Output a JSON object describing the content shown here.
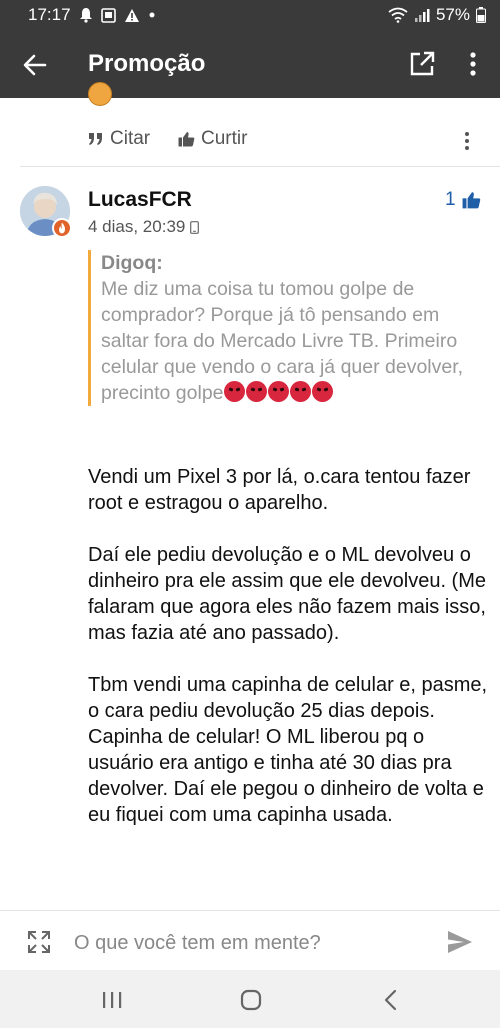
{
  "status_bar": {
    "time": "17:17",
    "battery": "57%",
    "icons": [
      "notification-icon",
      "image-icon",
      "alert-icon",
      "dot-icon",
      "wifi-icon",
      "signal-icon",
      "battery-icon"
    ]
  },
  "app_bar": {
    "title": "Promoção",
    "back_icon": "arrow-left-icon",
    "open_icon": "open-external-icon",
    "more_icon": "more-vertical-icon"
  },
  "prev_post": {
    "actions": {
      "cite_label": "Citar",
      "like_label": "Curtir"
    }
  },
  "post": {
    "username": "LucasFCR",
    "time": "4 dias, 20:39",
    "likes": "1",
    "quote": {
      "author": "Digoq:",
      "text": "Me diz uma coisa tu tomou golpe de comprador? Porque já tô pensando em saltar fora do Mercado Livre TB. Primeiro celular que vendo o cara já quer devolver, precinto golpe"
    },
    "paragraphs": [
      "Vendi um Pixel 3 por lá, o.cara tentou fazer root e estragou o aparelho.",
      "Daí ele pediu devolução e o ML devolveu o dinheiro pra ele assim que ele devolveu. (Me falaram que agora eles não fazem mais isso, mas fazia até ano passado).",
      "Tbm vendi uma capinha de celular e, pasme, o cara pediu devolução 25 dias depois. Capinha de celular! O ML liberou pq o usuário era antigo e tinha até 30 dias pra devolver. Daí ele pegou o dinheiro de volta e eu fiquei com uma capinha usada."
    ]
  },
  "composer": {
    "placeholder": "O que você tem em mente?"
  },
  "colors": {
    "app_bar": "#3a3a3a",
    "accent_link": "#1e5fa8",
    "quote_border": "#f2a93b"
  }
}
